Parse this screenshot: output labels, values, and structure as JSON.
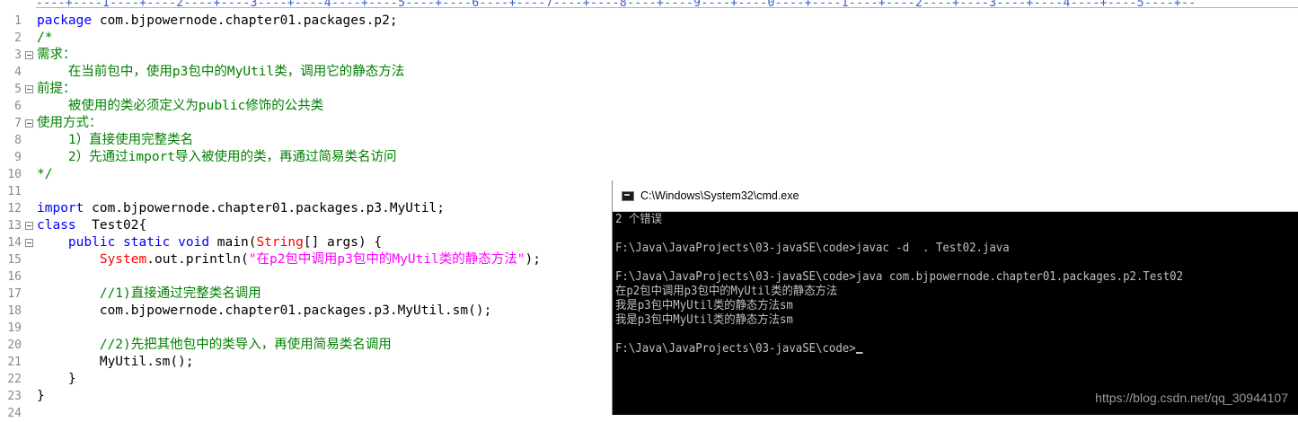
{
  "editor": {
    "ruler": "----+----1----+----2----+----3----+----4----+----5----+----6----+----7----+----8----+----9----+----0----+----1----+----2----+----3----+----4----+----5----+--",
    "lines": [
      {
        "n": "1",
        "fold": false,
        "segs": [
          {
            "c": "kw",
            "t": "package"
          },
          {
            "c": "",
            "t": " com.bjpowernode.chapter01.packages.p2;"
          }
        ]
      },
      {
        "n": "2",
        "fold": false,
        "segs": [
          {
            "c": "cm",
            "t": "/*"
          }
        ]
      },
      {
        "n": "3",
        "fold": true,
        "segs": [
          {
            "c": "cm",
            "t": "需求："
          }
        ]
      },
      {
        "n": "4",
        "fold": false,
        "segs": [
          {
            "c": "cm",
            "t": "    在当前包中，使用p3包中的MyUtil类，调用它的静态方法"
          }
        ]
      },
      {
        "n": "5",
        "fold": true,
        "segs": [
          {
            "c": "cm",
            "t": "前提："
          }
        ]
      },
      {
        "n": "6",
        "fold": false,
        "segs": [
          {
            "c": "cm",
            "t": "    被使用的类必须定义为public修饰的公共类"
          }
        ]
      },
      {
        "n": "7",
        "fold": true,
        "segs": [
          {
            "c": "cm",
            "t": "使用方式："
          }
        ]
      },
      {
        "n": "8",
        "fold": false,
        "segs": [
          {
            "c": "cm",
            "t": "    1）直接使用完整类名"
          }
        ]
      },
      {
        "n": "9",
        "fold": false,
        "segs": [
          {
            "c": "cm",
            "t": "    2）先通过import导入被使用的类，再通过简易类名访问"
          }
        ]
      },
      {
        "n": "10",
        "fold": false,
        "segs": [
          {
            "c": "cm",
            "t": "*/"
          }
        ]
      },
      {
        "n": "11",
        "fold": false,
        "segs": []
      },
      {
        "n": "12",
        "fold": false,
        "segs": [
          {
            "c": "kw",
            "t": "import"
          },
          {
            "c": "",
            "t": " com.bjpowernode.chapter01.packages.p3.MyUtil;"
          }
        ]
      },
      {
        "n": "13",
        "fold": true,
        "segs": [
          {
            "c": "kw",
            "t": "class"
          },
          {
            "c": "",
            "t": "  Test02{"
          }
        ]
      },
      {
        "n": "14",
        "fold": true,
        "segs": [
          {
            "c": "",
            "t": "    "
          },
          {
            "c": "kw",
            "t": "public static void"
          },
          {
            "c": "",
            "t": " main("
          },
          {
            "c": "cl",
            "t": "String"
          },
          {
            "c": "",
            "t": "[] args) {"
          }
        ]
      },
      {
        "n": "15",
        "fold": false,
        "segs": [
          {
            "c": "",
            "t": "        "
          },
          {
            "c": "cl",
            "t": "System"
          },
          {
            "c": "",
            "t": ".out.println("
          },
          {
            "c": "st",
            "t": "\"在p2包中调用p3包中的MyUtil类的静态方法\""
          },
          {
            "c": "",
            "t": ");"
          }
        ]
      },
      {
        "n": "16",
        "fold": false,
        "segs": []
      },
      {
        "n": "17",
        "fold": false,
        "segs": [
          {
            "c": "",
            "t": "        "
          },
          {
            "c": "cm",
            "t": "//1)直接通过完整类名调用"
          }
        ]
      },
      {
        "n": "18",
        "fold": false,
        "segs": [
          {
            "c": "",
            "t": "        com.bjpowernode.chapter01.packages.p3.MyUtil.sm();"
          }
        ]
      },
      {
        "n": "19",
        "fold": false,
        "segs": []
      },
      {
        "n": "20",
        "fold": false,
        "segs": [
          {
            "c": "",
            "t": "        "
          },
          {
            "c": "cm",
            "t": "//2)先把其他包中的类导入，再使用简易类名调用"
          }
        ]
      },
      {
        "n": "21",
        "fold": false,
        "segs": [
          {
            "c": "",
            "t": "        MyUtil.sm();"
          }
        ]
      },
      {
        "n": "22",
        "fold": false,
        "segs": [
          {
            "c": "",
            "t": "    }"
          }
        ]
      },
      {
        "n": "23",
        "fold": false,
        "segs": [
          {
            "c": "",
            "t": "}"
          }
        ]
      },
      {
        "n": "24",
        "fold": false,
        "segs": []
      }
    ]
  },
  "cmd": {
    "title": "C:\\Windows\\System32\\cmd.exe",
    "lines": [
      "2 个错误",
      "",
      "F:\\Java\\JavaProjects\\03-javaSE\\code>javac -d  . Test02.java",
      "",
      "F:\\Java\\JavaProjects\\03-javaSE\\code>java com.bjpowernode.chapter01.packages.p2.Test02",
      "在p2包中调用p3包中的MyUtil类的静态方法",
      "我是p3包中MyUtil类的静态方法sm",
      "我是p3包中MyUtil类的静态方法sm",
      "",
      "F:\\Java\\JavaProjects\\03-javaSE\\code>"
    ]
  },
  "watermark": "https://blog.csdn.net/qq_30944107",
  "colors": {
    "keyword": "#0000ff",
    "comment": "#008000",
    "string": "#ff00ff",
    "class": "#ff0000",
    "console_bg": "#000000",
    "console_text": "#c0c0c0"
  }
}
